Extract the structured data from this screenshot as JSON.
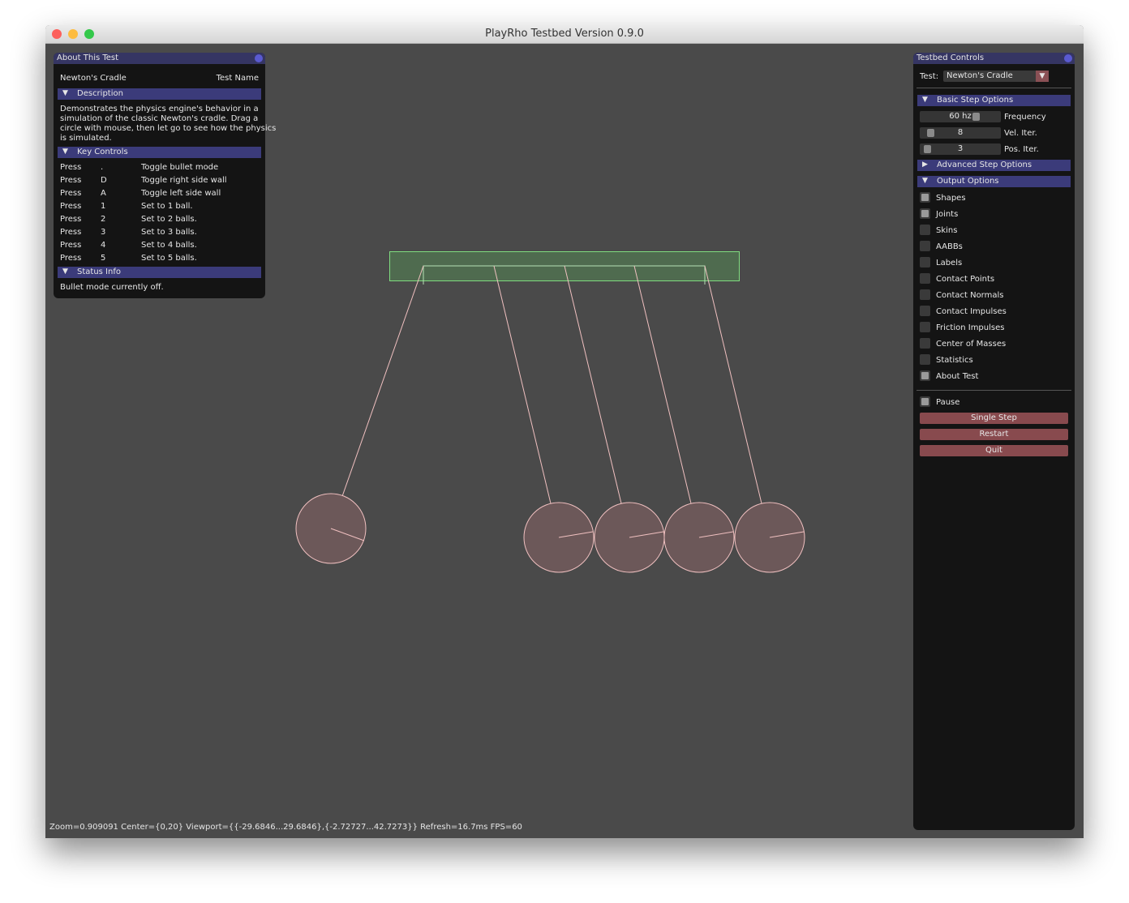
{
  "window": {
    "title": "PlayRho Testbed Version 0.9.0"
  },
  "about": {
    "title": "About This Test",
    "test_name": "Newton's Cradle",
    "test_name_label": "Test Name",
    "description_header": "Description",
    "description_lines": [
      "Demonstrates the physics engine's behavior in a",
      "simulation of the classic Newton's cradle. Drag a",
      "circle with mouse, then let go to see how the physics",
      "is simulated."
    ],
    "key_controls_header": "Key Controls",
    "keys": [
      {
        "action": "Press",
        "key": ".",
        "desc": "Toggle bullet mode"
      },
      {
        "action": "Press",
        "key": "D",
        "desc": "Toggle right side wall"
      },
      {
        "action": "Press",
        "key": "A",
        "desc": "Toggle left side wall"
      },
      {
        "action": "Press",
        "key": "1",
        "desc": "Set to 1 ball."
      },
      {
        "action": "Press",
        "key": "2",
        "desc": "Set to 2 balls."
      },
      {
        "action": "Press",
        "key": "3",
        "desc": "Set to 3 balls."
      },
      {
        "action": "Press",
        "key": "4",
        "desc": "Set to 4 balls."
      },
      {
        "action": "Press",
        "key": "5",
        "desc": "Set to 5 balls."
      }
    ],
    "status_header": "Status Info",
    "status_text": "Bullet mode currently off."
  },
  "controls": {
    "title": "Testbed Controls",
    "test_label": "Test:",
    "test_value": "Newton's Cradle",
    "basic_header": "Basic Step Options",
    "sliders": [
      {
        "value": "60 hz",
        "label": "Frequency",
        "level": 0.72
      },
      {
        "value": "8",
        "label": "Vel. Iter.",
        "level": 0.08
      },
      {
        "value": "3",
        "label": "Pos. Iter.",
        "level": 0.04
      }
    ],
    "advanced_header": "Advanced Step Options",
    "output_header": "Output Options",
    "options": [
      {
        "label": "Shapes",
        "checked": true
      },
      {
        "label": "Joints",
        "checked": true
      },
      {
        "label": "Skins",
        "checked": false
      },
      {
        "label": "AABBs",
        "checked": false
      },
      {
        "label": "Labels",
        "checked": false
      },
      {
        "label": "Contact Points",
        "checked": false
      },
      {
        "label": "Contact Normals",
        "checked": false
      },
      {
        "label": "Contact Impulses",
        "checked": false
      },
      {
        "label": "Friction Impulses",
        "checked": false
      },
      {
        "label": "Center of Masses",
        "checked": false
      },
      {
        "label": "Statistics",
        "checked": false
      },
      {
        "label": "About Test",
        "checked": true
      }
    ],
    "pause_label": "Pause",
    "buttons": [
      "Single Step",
      "Restart",
      "Quit"
    ]
  },
  "status_bar": "Zoom=0.909091 Center={0,20} Viewport={{-29.6846...29.6846},{-2.72727...42.7273}} Refresh=16.7ms FPS=60",
  "colors": {
    "background": "#4a4a4a",
    "panel": "#141414",
    "title": "#353563",
    "header": "#3b3b7a",
    "button": "#884a4e",
    "ball": "#6c5859",
    "ball_outline": "#f0c0c0",
    "beam_outline": "#7fdc7f"
  }
}
